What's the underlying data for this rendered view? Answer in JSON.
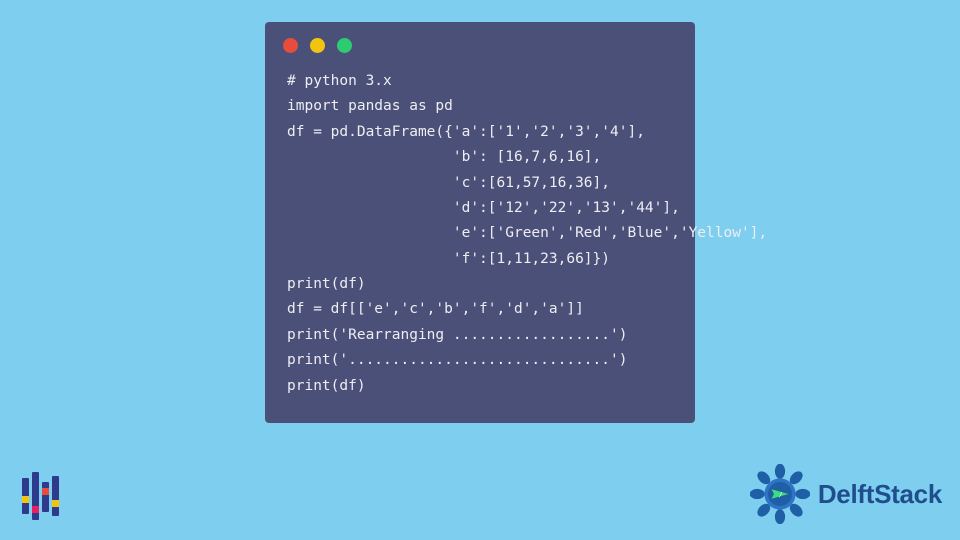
{
  "code": {
    "lines": [
      "# python 3.x",
      "import pandas as pd",
      "df = pd.DataFrame({'a':['1','2','3','4'],",
      "                   'b': [16,7,6,16],",
      "                   'c':[61,57,16,36],",
      "                   'd':['12','22','13','44'],",
      "                   'e':['Green','Red','Blue','Yellow'],",
      "                   'f':[1,11,23,66]})",
      "print(df)",
      "df = df[['e','c','b','f','d','a']]",
      "print('Rearranging ..................')",
      "print('..............................')",
      "print(df)"
    ]
  },
  "brand": {
    "name": "DelftStack"
  }
}
